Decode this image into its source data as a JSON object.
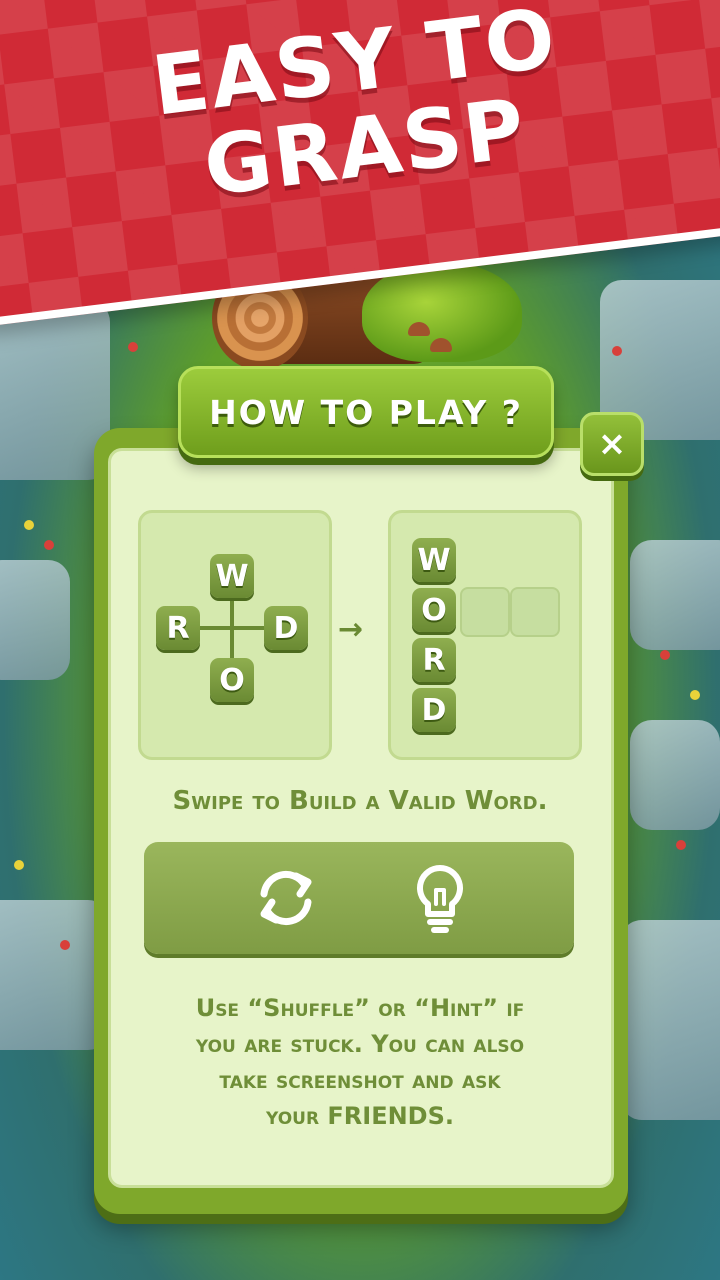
{
  "banner": {
    "line1": "EASY TO",
    "line2": "GRASP"
  },
  "dialog": {
    "title": "HOW TO PLAY ?",
    "close_label": "×",
    "demo": {
      "cross_letters": {
        "top": "W",
        "left": "R",
        "right": "D",
        "bottom": "O"
      },
      "arrow": "→",
      "result_letters": [
        "W",
        "O",
        "R",
        "D"
      ]
    },
    "instruction_1": "Swipe to Build a Valid Word.",
    "instruction_2_l1": "Use “Shuffle” or “Hint” if",
    "instruction_2_l2": "you are stuck. You can also",
    "instruction_2_l3": "take screenshot and ask",
    "instruction_2_l4": "your FRIENDS.",
    "tools": [
      {
        "icon": "shuffle-icon"
      },
      {
        "icon": "lightbulb-icon"
      }
    ]
  },
  "colors": {
    "banner_red": "#d02a36",
    "dialog_green": "#7fa82b",
    "panel_bg": "#e7f4c9",
    "text_green": "#6f8e38"
  }
}
